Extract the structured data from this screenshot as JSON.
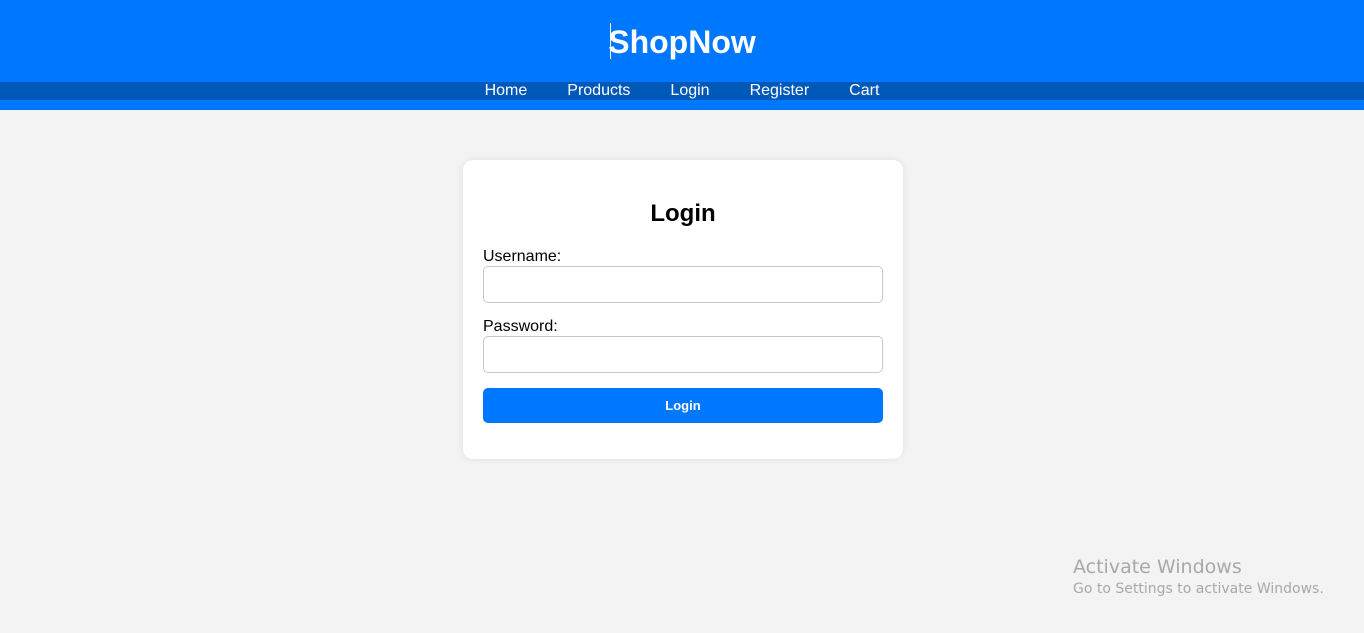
{
  "header": {
    "brand": "ShopNow"
  },
  "nav": {
    "items": [
      {
        "label": "Home"
      },
      {
        "label": "Products"
      },
      {
        "label": "Login"
      },
      {
        "label": "Register"
      },
      {
        "label": "Cart"
      }
    ]
  },
  "login_form": {
    "title": "Login",
    "username_label": "Username:",
    "username_value": "",
    "password_label": "Password:",
    "password_value": "",
    "submit_label": "Login"
  },
  "watermark": {
    "title": "Activate Windows",
    "subtitle": "Go to Settings to activate Windows."
  },
  "colors": {
    "primary": "#0077ff",
    "nav_bar": "#0059b8",
    "page_background": "#f3f3f3",
    "card_background": "#ffffff"
  }
}
